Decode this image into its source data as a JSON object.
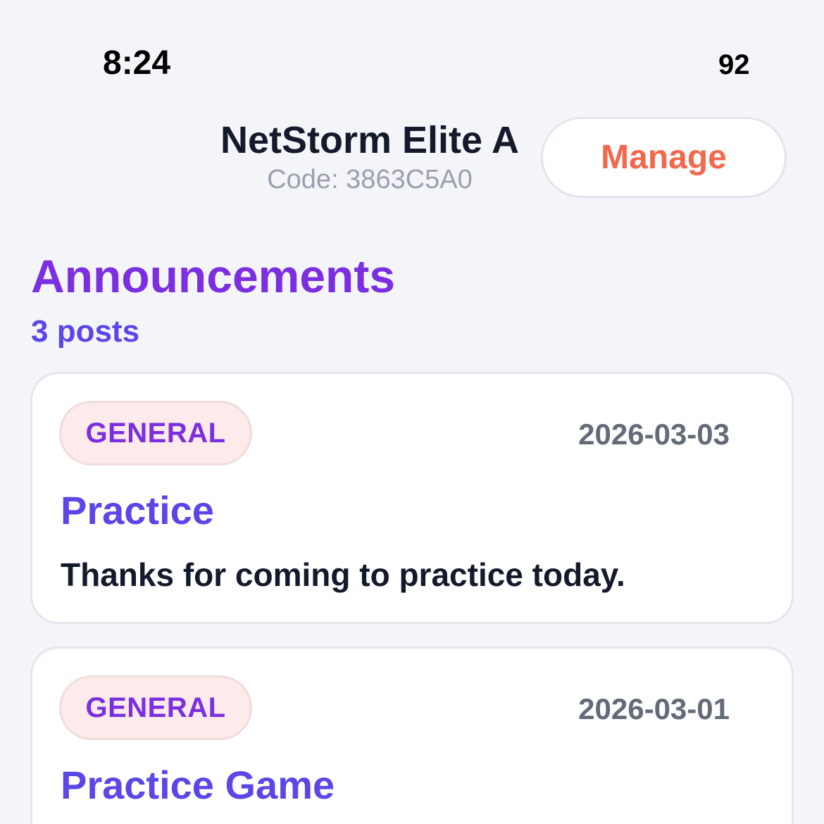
{
  "status_bar": {
    "time": "8:24",
    "battery": "92"
  },
  "team": {
    "name": "NetStorm Elite A",
    "code": "Code: 3863C5A0"
  },
  "header": {
    "manage_label": "Manage"
  },
  "announcements": {
    "title": "Announcements",
    "count_label": "3 posts",
    "posts": [
      {
        "category": "GENERAL",
        "date": "2026-03-03",
        "title": "Practice",
        "body": "Thanks for coming to practice today."
      },
      {
        "category": "GENERAL",
        "date": "2026-03-01",
        "title": "Practice Game"
      }
    ]
  },
  "colors": {
    "accent_purple": "#7b2fe0",
    "accent_indigo": "#5b46e8",
    "manage_orange": "#f2684c",
    "background": "#f4f5f9"
  }
}
